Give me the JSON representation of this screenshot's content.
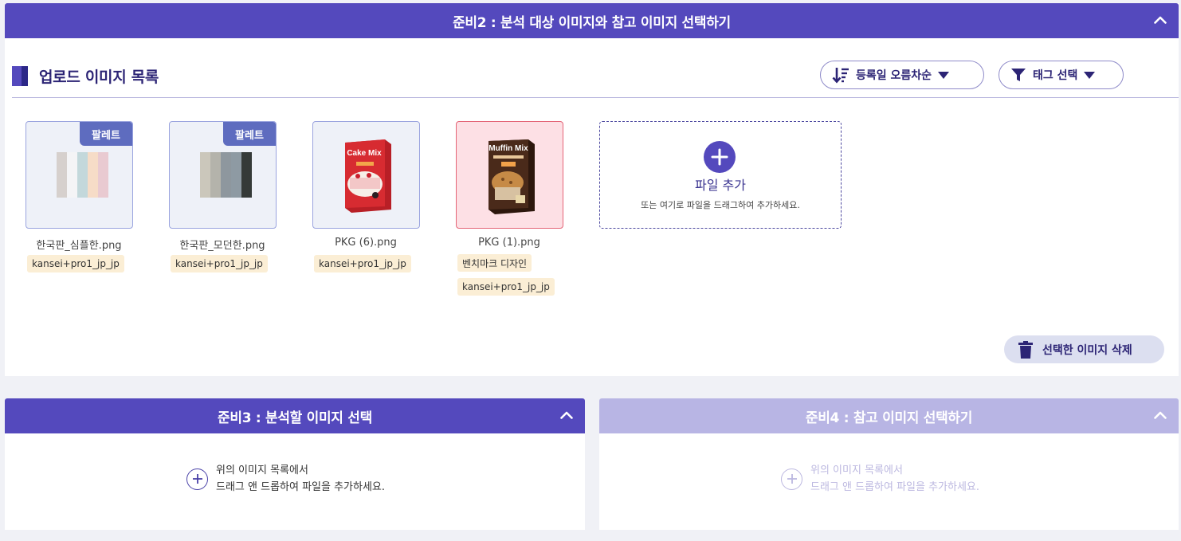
{
  "prep2": {
    "title": "준비2 : 분석 대상 이미지와 참고 이미지 선택하기",
    "section_title": "업로드 이미지 목록",
    "sort_label": "등록일 오름차순",
    "tag_filter_label": "태그 선택",
    "images": [
      {
        "name": "한국판_심플한.png",
        "badge": "팔레트",
        "tags": [
          "kansei+pro1_jp_jp"
        ],
        "swatches": [
          "#d6d0cd",
          "#f4f4f6",
          "#c3d8db",
          "#f6dcc7",
          "#e9cad1"
        ]
      },
      {
        "name": "한국판_모던한.png",
        "badge": "팔레트",
        "tags": [
          "kansei+pro1_jp_jp"
        ],
        "swatches": [
          "#cbc7bb",
          "#b4b3ab",
          "#8e979e",
          "#8e9aa3",
          "#353a38"
        ]
      },
      {
        "name": "PKG (6).png",
        "badge": "",
        "tags": [
          "kansei+pro1_jp_jp"
        ],
        "box_text": "Cake Mix",
        "box_color": "#d72b31"
      },
      {
        "name": "PKG (1).png",
        "badge": "",
        "tags": [
          "벤치마크 디자인",
          "kansei+pro1_jp_jp"
        ],
        "box_text": "Muffin Mix",
        "box_color": "#4a2a1a"
      }
    ],
    "add_file": {
      "title": "파일 추가",
      "hint": "또는 여기로 파일을 드래그하여 추가하세요."
    },
    "delete_label": "선택한 이미지 삭제"
  },
  "prep3": {
    "title": "준비3 : 분석할 이미지 선택",
    "hint_line1": "위의 이미지 목록에서",
    "hint_line2": "드래그 앤 드롭하여 파일을 추가하세요."
  },
  "prep4": {
    "title": "준비4 : 참고 이미지 선택하기",
    "hint_line1": "위의 이미지 목록에서",
    "hint_line2": "드래그 앤 드롭하여 파일을 추가하세요."
  },
  "colors": {
    "accent": "#5449bd",
    "accent_light": "#b8b5e4",
    "tag_bg": "#fbeed5",
    "selected_bg": "#fde0e5"
  }
}
